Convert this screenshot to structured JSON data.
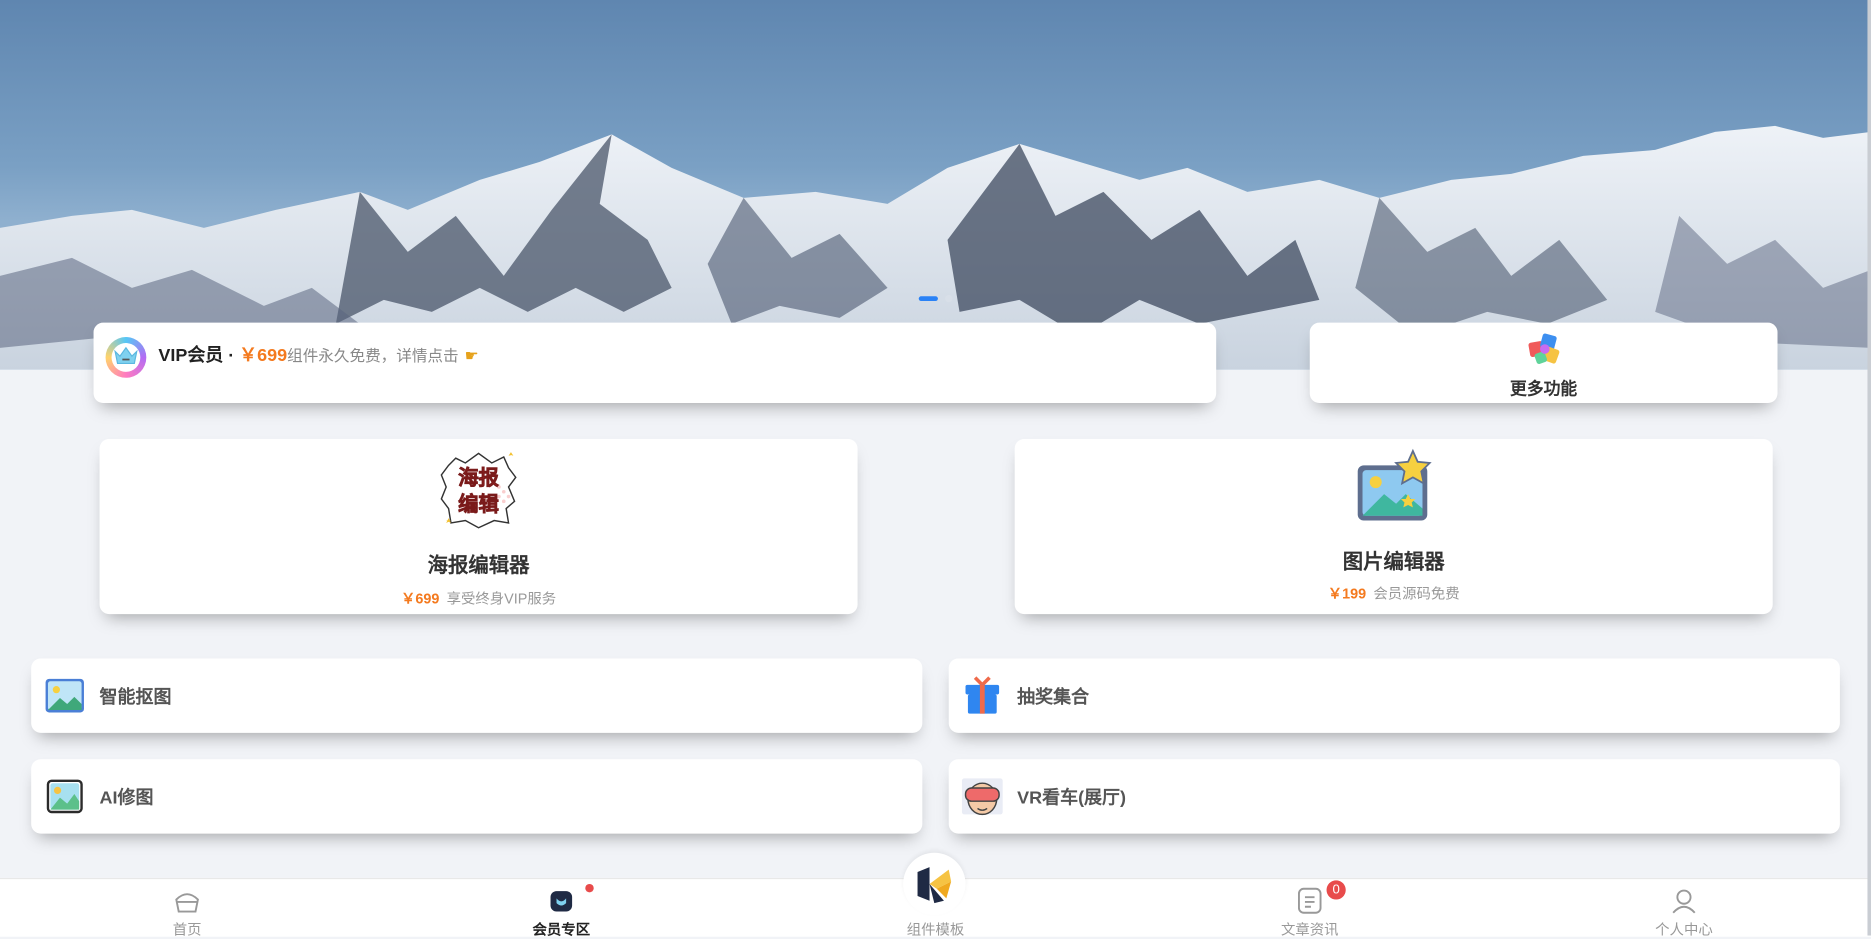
{
  "vip": {
    "title": "VIP会员 · ",
    "price": "￥699",
    "desc": "组件永久免费，详情点击",
    "hand_icon": "pointing-hand-icon"
  },
  "more": {
    "label": "更多功能",
    "icon": "puzzle-icon"
  },
  "cards": [
    {
      "title": "海报编辑器",
      "price": "￥699",
      "desc": "享受终身VIP服务",
      "icon": "poster-icon",
      "icon_text_1": "海报",
      "icon_text_2": "编辑"
    },
    {
      "title": "图片编辑器",
      "price": "￥199",
      "desc": "会员源码免费",
      "icon": "image-editor-icon"
    }
  ],
  "items": [
    {
      "label": "智能抠图",
      "icon": "picture-icon"
    },
    {
      "label": "抽奖集合",
      "icon": "gift-icon"
    },
    {
      "label": "AI修图",
      "icon": "landscape-photo-icon"
    },
    {
      "label": "VR看车(展厅)",
      "icon": "vr-headset-icon"
    }
  ],
  "tabs": [
    {
      "label": "首页",
      "icon": "home-icon"
    },
    {
      "label": "会员专区",
      "icon": "member-icon",
      "active": true,
      "dot": true
    },
    {
      "label": "组件模板",
      "icon": "k-logo-icon"
    },
    {
      "label": "文章资讯",
      "icon": "article-icon",
      "badge": "0"
    },
    {
      "label": "个人中心",
      "icon": "user-icon"
    }
  ],
  "colors": {
    "accent": "#f47a1f",
    "primary": "#2a82f6",
    "badge": "#e84b4b",
    "background": "#f1f3f7"
  }
}
